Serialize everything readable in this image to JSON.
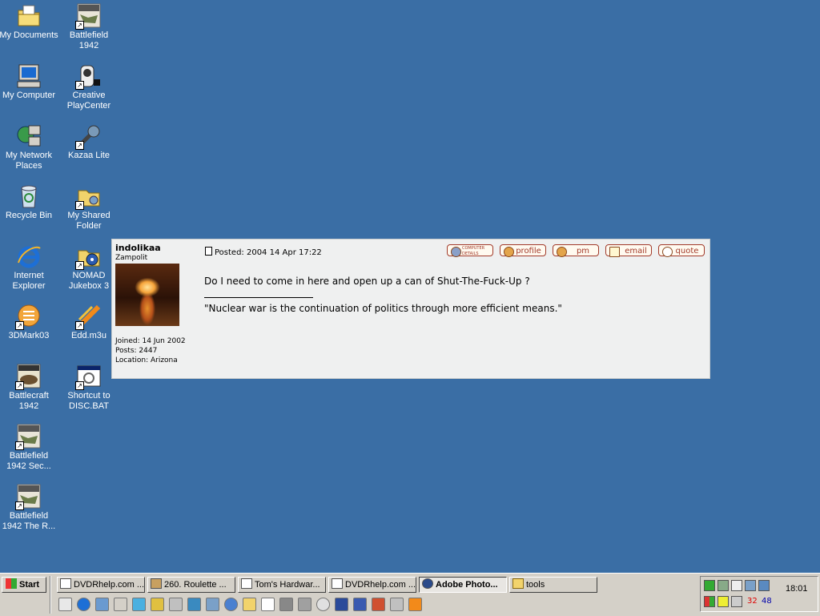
{
  "desktop": {
    "icons": [
      {
        "label": "My Documents",
        "icon": "folder-documents-icon"
      },
      {
        "label": "Battlefield\n1942",
        "icon": "battlefield-1942-icon"
      },
      {
        "label": "My Computer",
        "icon": "computer-icon"
      },
      {
        "label": "Creative\nPlayCenter",
        "icon": "creative-playcenter-icon"
      },
      {
        "label": "My Network\nPlaces",
        "icon": "network-places-icon"
      },
      {
        "label": "Kazaa Lite",
        "icon": "kazaa-icon"
      },
      {
        "label": "Recycle Bin",
        "icon": "recycle-bin-icon"
      },
      {
        "label": "My Shared\nFolder",
        "icon": "shared-folder-icon"
      },
      {
        "label": "Internet\nExplorer",
        "icon": "internet-explorer-icon"
      },
      {
        "label": "NOMAD\nJukebox 3",
        "icon": "nomad-jukebox-icon"
      },
      {
        "label": "3DMark03",
        "icon": "3dmark-icon"
      },
      {
        "label": "Edd.m3u",
        "icon": "playlist-icon"
      },
      {
        "label": "Battlecraft\n1942",
        "icon": "battlecraft-icon"
      },
      {
        "label": "Shortcut to\nDISC.BAT",
        "icon": "batch-file-icon"
      },
      {
        "label": "Battlefield\n1942 Sec...",
        "icon": "battlefield-secret-weapons-icon"
      },
      {
        "label": "Battlefield\n1942 The R...",
        "icon": "battlefield-road-to-rome-icon"
      }
    ]
  },
  "post": {
    "username": "indolikaa",
    "rank": "Zampolit",
    "joined": "Joined: 14 Jun 2002",
    "posts": "Posts: 2447",
    "location": "Location: Arizona",
    "posted": "Posted: 2004 14 Apr 17:22",
    "buttons": {
      "computer": "COMPUTER DETAILS",
      "profile": "profile",
      "pm": "pm",
      "email": "email",
      "quote": "quote"
    },
    "message": "Do I need to come in here and open up a can of Shut-The-Fuck-Up ?",
    "signature": "\"Nuclear war is the continuation of politics through more efficient means.\""
  },
  "taskbar": {
    "start": "Start",
    "tasks": [
      {
        "label": "DVDRhelp.com ...",
        "icon": "ie-page-icon"
      },
      {
        "label": "260. Roulette ...",
        "icon": "roulette-icon"
      },
      {
        "label": "Tom's Hardwar...",
        "icon": "ie-page-icon"
      },
      {
        "label": "DVDRhelp.com ...",
        "icon": "ie-page-icon"
      },
      {
        "label": "Adobe Photo...",
        "icon": "photoshop-icon"
      },
      {
        "label": "tools",
        "icon": "folder-icon"
      }
    ],
    "tray": {
      "clock": "18:01",
      "num1": "32",
      "num2": "48"
    }
  }
}
